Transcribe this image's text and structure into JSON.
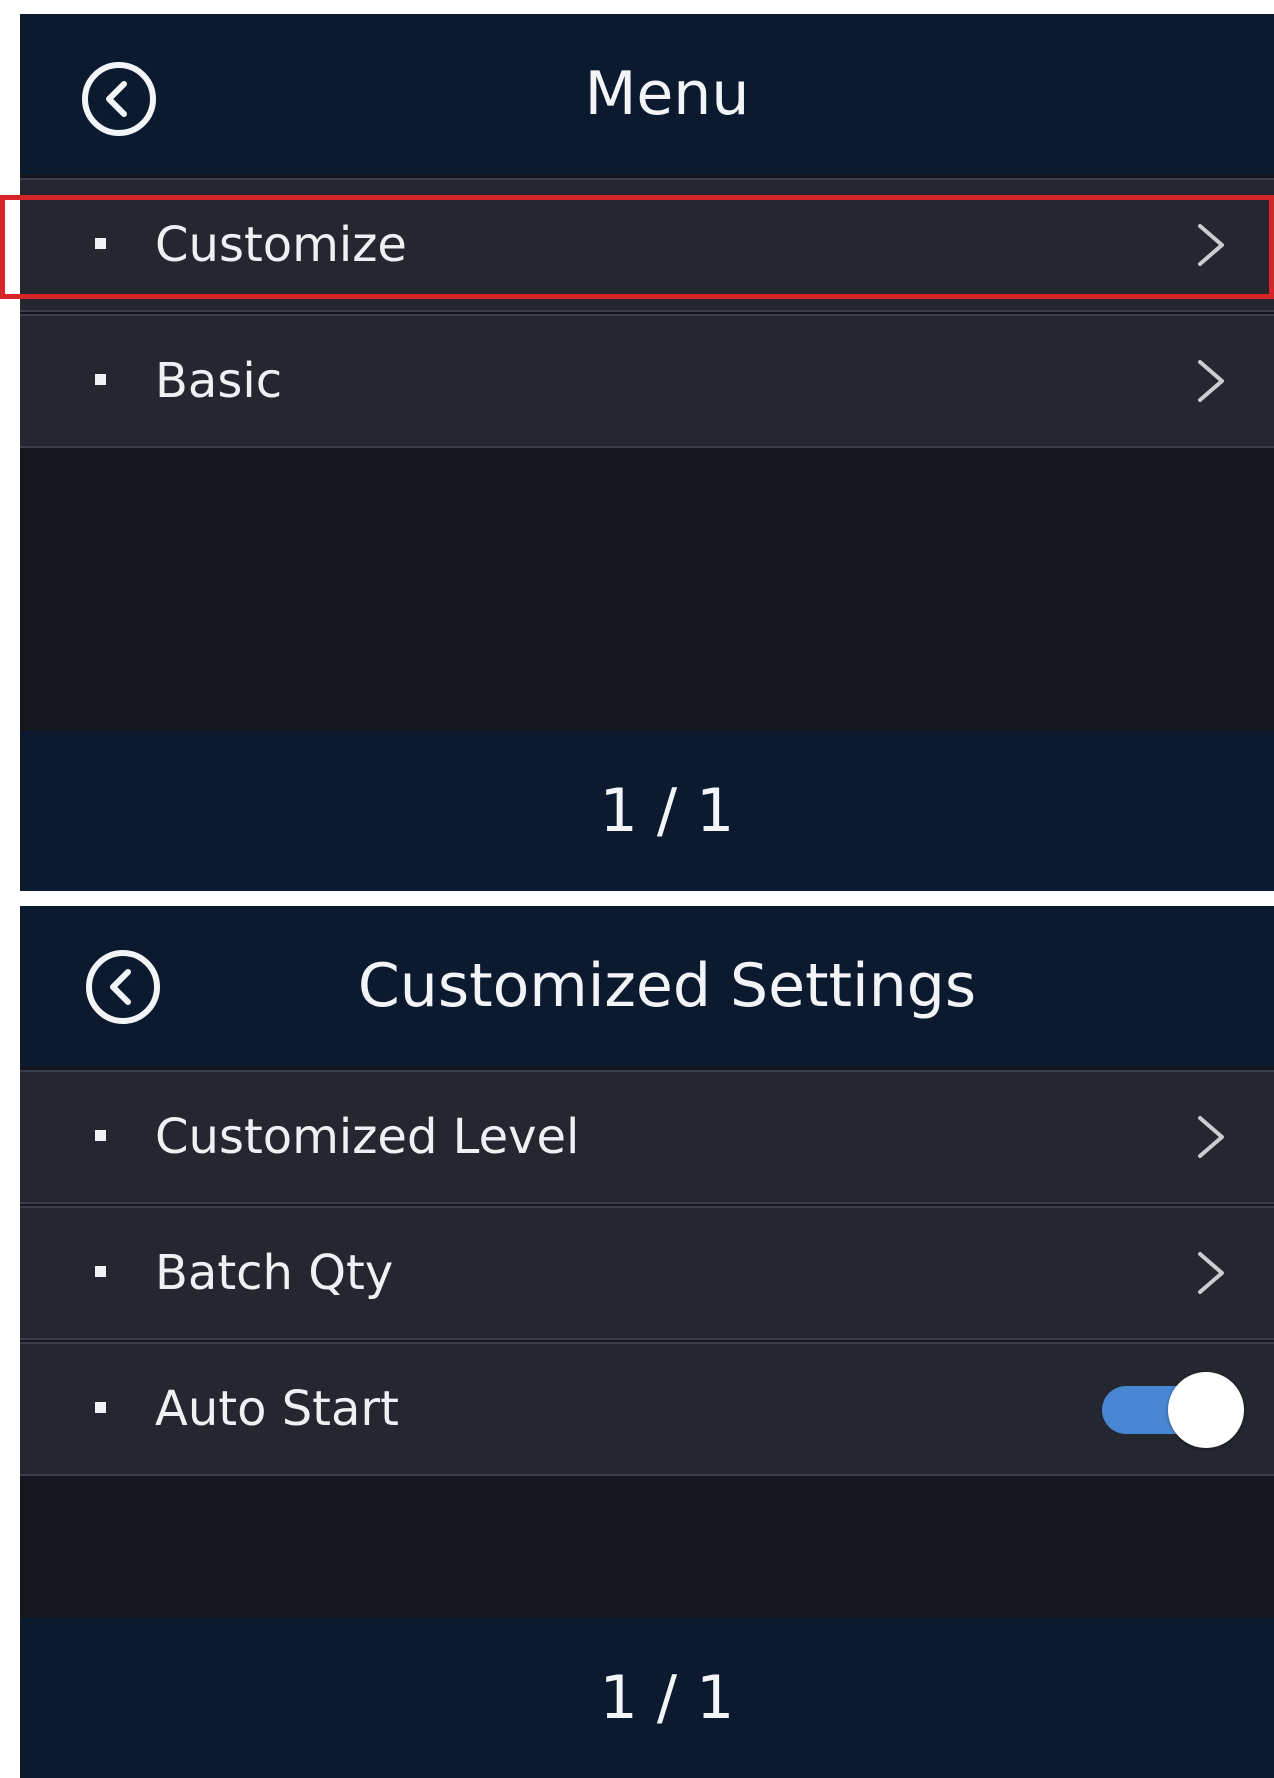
{
  "menu_screen": {
    "title": "Menu",
    "back_icon": "back-circle-icon",
    "items": [
      {
        "label": "Customize",
        "icon": "chevron-right-icon",
        "highlighted": true
      },
      {
        "label": "Basic",
        "icon": "chevron-right-icon",
        "highlighted": false
      }
    ],
    "page_indicator": "1 / 1"
  },
  "custom_screen": {
    "title": "Customized Settings",
    "back_icon": "back-circle-icon",
    "items": [
      {
        "label": "Customized Level",
        "icon": "chevron-right-icon"
      },
      {
        "label": "Batch Qty",
        "icon": "chevron-right-icon"
      },
      {
        "label": "Auto Start",
        "toggle_on": true
      }
    ],
    "page_indicator": "1 / 1"
  },
  "colors": {
    "header_bg": "#0c1a2f",
    "row_bg": "#242730",
    "screen_bg": "#14171d",
    "highlight": "#d62428",
    "toggle_on": "#4a87d3"
  }
}
